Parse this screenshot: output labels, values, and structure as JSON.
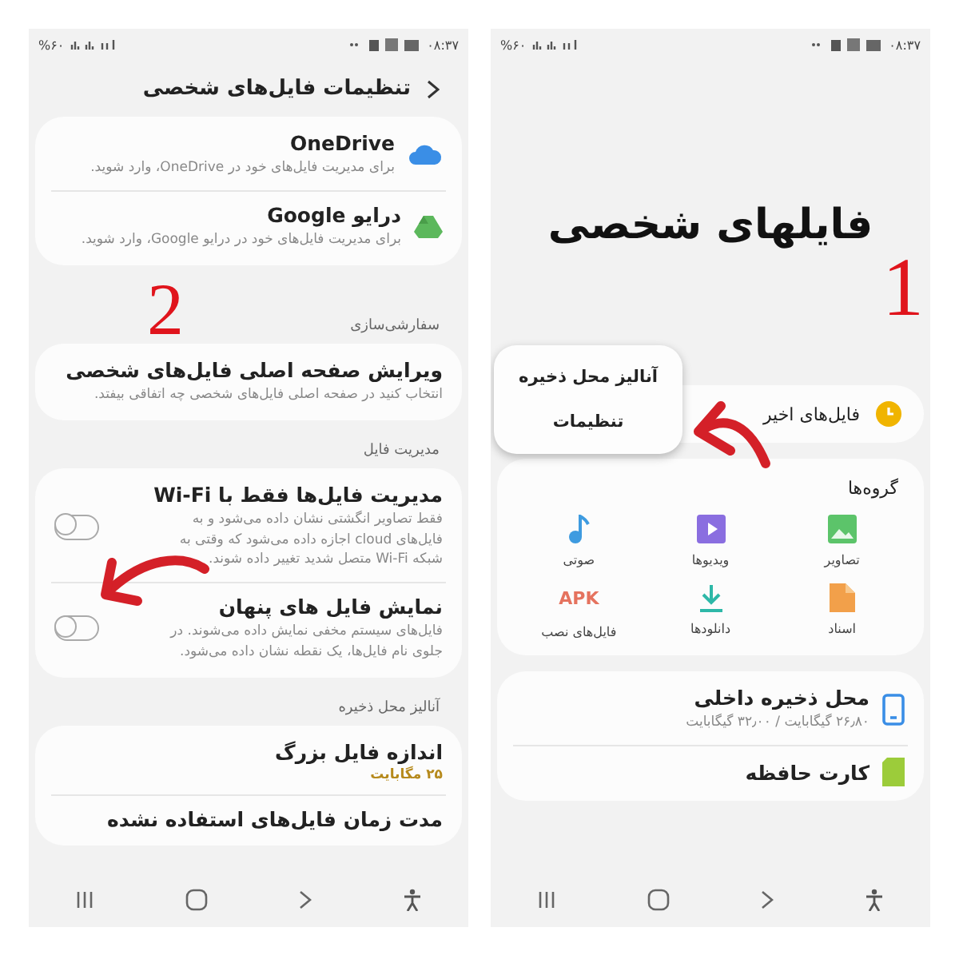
{
  "phones": [
    {
      "kind": "home",
      "status_bar": {
        "time": "۰۸:۳۷",
        "battery": "%۶۰"
      },
      "annotation": "1",
      "title": "فایلهای شخصی",
      "menu": [
        "آنالیز محل ذخیره",
        "تنظیمات"
      ],
      "recent": "فایل‌های اخیر",
      "groups": {
        "title": "گروه‌ها",
        "items": [
          {
            "label": "تصاویر"
          },
          {
            "label": "ویدیوها"
          },
          {
            "label": "صوتی"
          },
          {
            "label": "اسناد"
          },
          {
            "label": "دانلودها"
          },
          {
            "label": "فایل‌های نصب",
            "icon_text": "APK"
          }
        ]
      },
      "storage": [
        {
          "title": "محل ذخیره داخلی",
          "subtitle": "۲۶٫۸۰ گیگابایت / ۳۲٫۰۰ گیگابایت"
        },
        {
          "title": "کارت حافظه"
        }
      ]
    },
    {
      "kind": "settings",
      "status_bar": {
        "time": "۰۸:۳۷",
        "battery": "%۶۰"
      },
      "annotation": "2",
      "title": "تنظیمات فایل‌های شخصی",
      "sections": [
        {
          "items": [
            {
              "title": "OneDrive",
              "subtitle": "برای مدیریت فایل‌های خود در OneDrive، وارد شوید."
            },
            {
              "title": "درایو Google",
              "subtitle": "برای مدیریت فایل‌های خود در درایو Google، وارد شوید."
            }
          ]
        },
        {
          "title": "سفارشی‌سازی",
          "items": [
            {
              "title": "ویرایش صفحه اصلی فایل‌های شخصی",
              "subtitle": "انتخاب کنید در صفحه اصلی فایل‌های شخصی چه اتفاقی بیفتد."
            }
          ]
        },
        {
          "title": "مدیریت فایل",
          "items": [
            {
              "title": "مدیریت فایل‌ها فقط با Wi-Fi",
              "subtitle": "فقط تصاویر انگشتی نشان داده می‌شود و به فایل‌های cloud اجازه داده می‌شود که وقتی به شبکه Wi-Fi متصل شدید تغییر داده شوند.",
              "on": false
            },
            {
              "title": "نمایش فایل های پنهان",
              "subtitle": "فایل‌های سیستم مخفی نمایش داده می‌شوند. در جلوی نام فایل‌ها، یک نقطه نشان داده می‌شود.",
              "on": false
            }
          ]
        },
        {
          "title": "آنالیز محل ذخیره",
          "items": [
            {
              "title": "اندازه فایل بزرگ",
              "value": "۲۵ مگابایت"
            },
            {
              "title": "مدت زمان فایل‌های استفاده نشده"
            }
          ]
        }
      ]
    }
  ]
}
